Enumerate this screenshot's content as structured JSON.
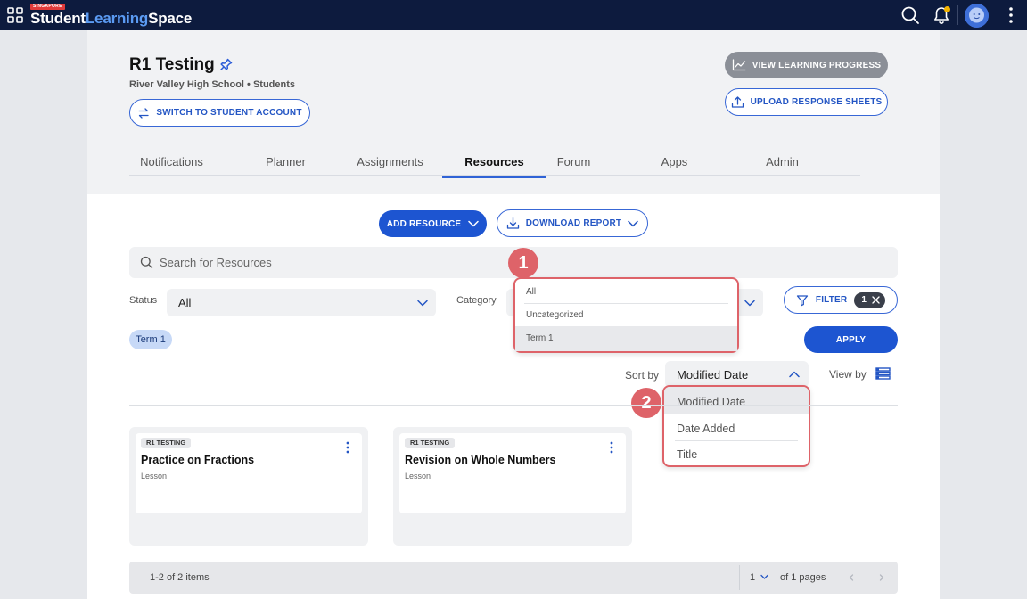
{
  "topbar": {
    "brand_tag": "SINGAPORE",
    "brand_student": "Student",
    "brand_learning": "Learning",
    "brand_space": "Space",
    "icons": [
      "apps-grid-icon",
      "search-icon",
      "bell-icon",
      "avatar",
      "more-vertical-icon"
    ],
    "accent_color": "#0d1b3e",
    "notification_dot_color": "#f4b400"
  },
  "header": {
    "title": "R1 Testing",
    "subtitle": "River Valley High School • Students",
    "switch_account_label": "SWITCH TO STUDENT ACCOUNT",
    "view_progress_label": "VIEW LEARNING PROGRESS",
    "upload_label": "UPLOAD RESPONSE SHEETS"
  },
  "tabs": [
    {
      "label": "Notifications"
    },
    {
      "label": "Planner"
    },
    {
      "label": "Assignments"
    },
    {
      "label": "Resources",
      "active": true
    },
    {
      "label": "Forum"
    },
    {
      "label": "Apps"
    },
    {
      "label": "Admin"
    }
  ],
  "actions": {
    "add_resource_label": "ADD RESOURCE",
    "download_report_label": "DOWNLOAD REPORT"
  },
  "search": {
    "placeholder": "Search for Resources"
  },
  "filters": {
    "status_label": "Status",
    "status_value": "All",
    "category_label": "Category",
    "category_options": [
      "All",
      "Uncategorized",
      "Term 1"
    ],
    "category_highlighted": "Term 1",
    "filter_label": "FILTER",
    "filter_count": "1",
    "apply_label": "APPLY",
    "active_chip": "Term 1"
  },
  "sort": {
    "label": "Sort by",
    "value": "Modified Date",
    "options": [
      "Modified Date",
      "Date Added",
      "Title"
    ],
    "view_by_label": "View by"
  },
  "callouts": [
    "1",
    "2"
  ],
  "callout_color": "#de6369",
  "resources": [
    {
      "tag": "R1 TESTING",
      "title": "Practice on Fractions",
      "type": "Lesson"
    },
    {
      "tag": "R1 TESTING",
      "title": "Revision on Whole Numbers",
      "type": "Lesson"
    }
  ],
  "pagination": {
    "items_text": "1-2 of 2 items",
    "page": "1",
    "pages_text": "of 1 pages"
  }
}
